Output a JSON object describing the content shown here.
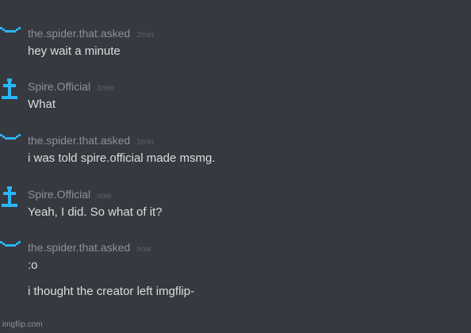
{
  "colors": {
    "background": "#36393f",
    "username": "#8e9297",
    "timestamp": "#5f6368",
    "message_text": "#dcddde",
    "avatar_accent": "#29b6f6"
  },
  "messages": [
    {
      "username": "the.spider.that.asked",
      "timestamp": "2min",
      "avatar_icon": "spider-face-icon",
      "lines": [
        "hey wait a minute"
      ]
    },
    {
      "username": "Spire.Official",
      "timestamp": "1min",
      "avatar_icon": "spire-cross-icon",
      "lines": [
        "What"
      ]
    },
    {
      "username": "the.spider.that.asked",
      "timestamp": "1min",
      "avatar_icon": "spider-face-icon",
      "lines": [
        "i was told spire.official made msmg."
      ]
    },
    {
      "username": "Spire.Official",
      "timestamp": "now",
      "avatar_icon": "spire-cross-icon",
      "lines": [
        "Yeah, I did. So what of it?"
      ]
    },
    {
      "username": "the.spider.that.asked",
      "timestamp": "now",
      "avatar_icon": "spider-face-icon",
      "lines": [
        ":o",
        "i thought the creator left imgflip-"
      ]
    }
  ],
  "watermark": "imgflip.com"
}
